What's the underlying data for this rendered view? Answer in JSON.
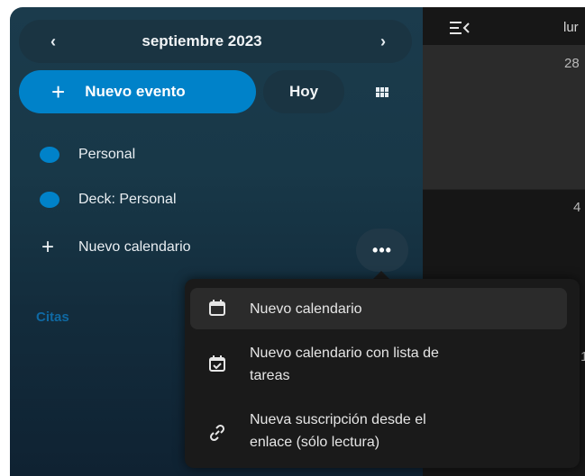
{
  "header": {
    "prev_icon": "chevron-left-icon",
    "month": "septiembre 2023",
    "next_icon": "chevron-right-icon"
  },
  "actions": {
    "new_event_label": "Nuevo evento",
    "today_label": "Hoy",
    "view_icon": "grid-view-icon"
  },
  "calendars": [
    {
      "label": "Personal",
      "color": "#0082c9"
    },
    {
      "label": "Deck: Personal",
      "color": "#0082c9"
    }
  ],
  "new_calendar_label": "Nuevo calendario",
  "more_label": "•••",
  "section_title": "Citas",
  "grid": {
    "day_header": "lur",
    "day_numbers": [
      "28",
      "4",
      "1"
    ]
  },
  "menu": {
    "items": [
      {
        "label": "Nuevo calendario",
        "icon": "calendar-icon"
      },
      {
        "label_line1": "Nuevo calendario con lista de",
        "label_line2": "tareas",
        "icon": "calendar-check-icon"
      },
      {
        "label_line1": "Nueva suscripción desde el",
        "label_line2": "enlace (sólo lectura)",
        "icon": "link-icon"
      }
    ]
  },
  "colors": {
    "accent": "#0082c9",
    "sidebar_bg": "#183848",
    "menu_bg": "#1a1a1a"
  }
}
